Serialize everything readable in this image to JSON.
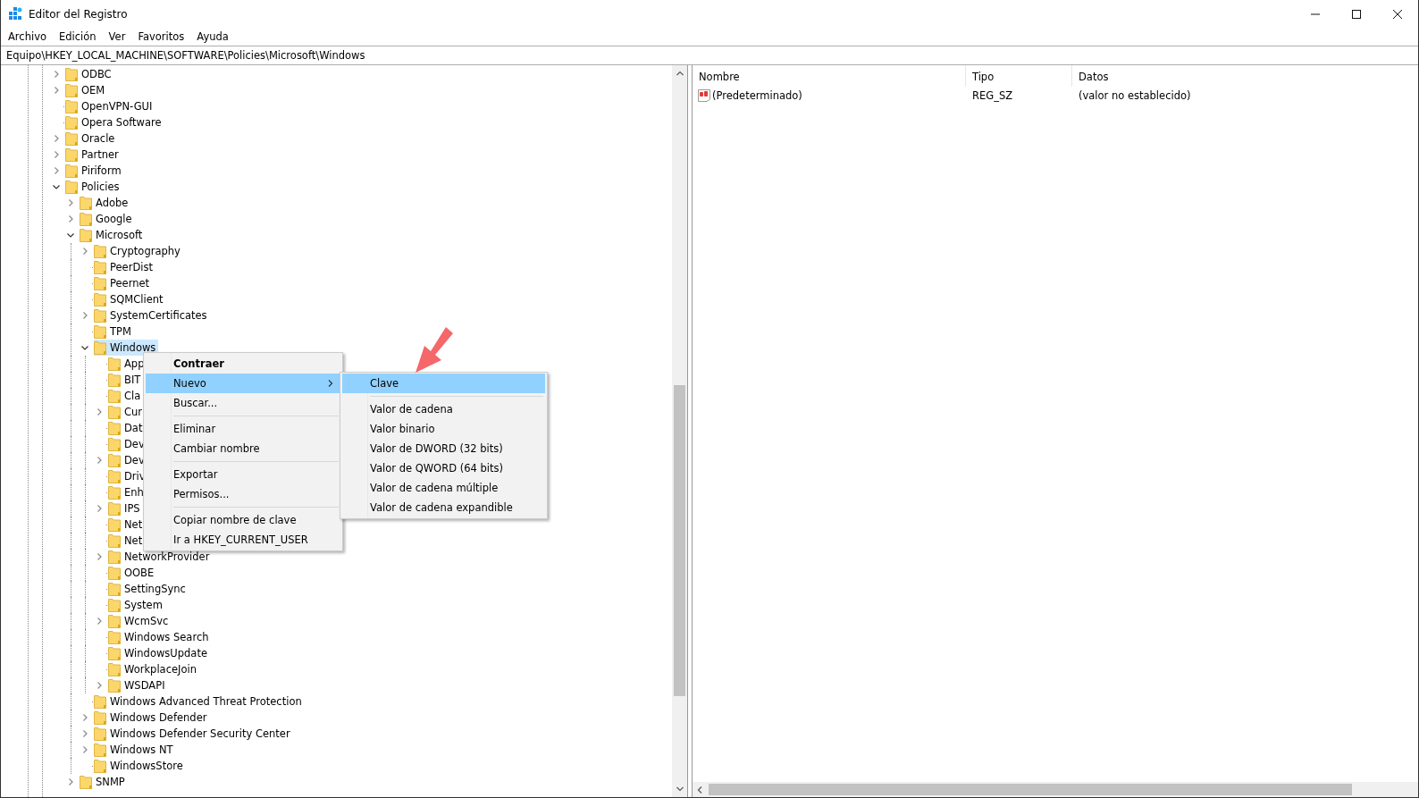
{
  "window": {
    "title": "Editor del Registro"
  },
  "menu_bar": [
    "Archivo",
    "Edición",
    "Ver",
    "Favoritos",
    "Ayuda"
  ],
  "address": "Equipo\\HKEY_LOCAL_MACHINE\\SOFTWARE\\Policies\\Microsoft\\Windows",
  "tree": [
    {
      "label": "ODBC",
      "kind": "closed",
      "selected": false
    },
    {
      "label": "OEM",
      "kind": "closed",
      "selected": false
    },
    {
      "label": "OpenVPN-GUI",
      "kind": "leaf",
      "selected": false
    },
    {
      "label": "Opera Software",
      "kind": "leaf",
      "selected": false
    },
    {
      "label": "Oracle",
      "kind": "closed",
      "selected": false
    },
    {
      "label": "Partner",
      "kind": "closed",
      "selected": false
    },
    {
      "label": "Piriform",
      "kind": "closed",
      "selected": false
    },
    {
      "label": "Policies",
      "kind": "open",
      "selected": false,
      "children": [
        {
          "label": "Adobe",
          "kind": "closed",
          "selected": false
        },
        {
          "label": "Google",
          "kind": "closed",
          "selected": false
        },
        {
          "label": "Microsoft",
          "kind": "open",
          "selected": false,
          "children": [
            {
              "label": "Cryptography",
              "kind": "closed",
              "selected": false
            },
            {
              "label": "PeerDist",
              "kind": "leaf",
              "selected": false
            },
            {
              "label": "Peernet",
              "kind": "leaf",
              "selected": false
            },
            {
              "label": "SQMClient",
              "kind": "leaf",
              "selected": false
            },
            {
              "label": "SystemCertificates",
              "kind": "closed",
              "selected": false
            },
            {
              "label": "TPM",
              "kind": "leaf",
              "selected": false
            },
            {
              "label": "Windows",
              "kind": "open",
              "selected": true,
              "children": [
                {
                  "label": "App",
                  "kind": "leaf",
                  "selected": false
                },
                {
                  "label": "BIT",
                  "kind": "leaf",
                  "selected": false
                },
                {
                  "label": "Cla",
                  "kind": "leaf",
                  "selected": false
                },
                {
                  "label": "Cur",
                  "kind": "closed",
                  "selected": false
                },
                {
                  "label": "Dat",
                  "kind": "leaf",
                  "selected": false
                },
                {
                  "label": "Dev",
                  "kind": "leaf",
                  "selected": false
                },
                {
                  "label": "Dev",
                  "kind": "closed",
                  "selected": false
                },
                {
                  "label": "Driv",
                  "kind": "leaf",
                  "selected": false
                },
                {
                  "label": "Enh",
                  "kind": "leaf",
                  "selected": false
                },
                {
                  "label": "IPS",
                  "kind": "closed",
                  "selected": false
                },
                {
                  "label": "Net",
                  "kind": "leaf",
                  "selected": false
                },
                {
                  "label": "Net",
                  "kind": "leaf",
                  "selected": false
                },
                {
                  "label": "NetworkProvider",
                  "kind": "closed",
                  "selected": false
                },
                {
                  "label": "OOBE",
                  "kind": "leaf",
                  "selected": false
                },
                {
                  "label": "SettingSync",
                  "kind": "leaf",
                  "selected": false
                },
                {
                  "label": "System",
                  "kind": "leaf",
                  "selected": false
                },
                {
                  "label": "WcmSvc",
                  "kind": "closed",
                  "selected": false
                },
                {
                  "label": "Windows Search",
                  "kind": "leaf",
                  "selected": false
                },
                {
                  "label": "WindowsUpdate",
                  "kind": "leaf",
                  "selected": false
                },
                {
                  "label": "WorkplaceJoin",
                  "kind": "leaf",
                  "selected": false
                },
                {
                  "label": "WSDAPI",
                  "kind": "closed",
                  "selected": false
                }
              ]
            },
            {
              "label": "Windows Advanced Threat Protection",
              "kind": "leaf",
              "selected": false
            },
            {
              "label": "Windows Defender",
              "kind": "closed",
              "selected": false
            },
            {
              "label": "Windows Defender Security Center",
              "kind": "closed",
              "selected": false
            },
            {
              "label": "Windows NT",
              "kind": "closed",
              "selected": false
            },
            {
              "label": "WindowsStore",
              "kind": "leaf",
              "selected": false
            }
          ]
        },
        {
          "label": "SNMP",
          "kind": "closed",
          "selected": false
        }
      ]
    }
  ],
  "values_table": {
    "columns": [
      "Nombre",
      "Tipo",
      "Datos"
    ],
    "rows": [
      {
        "name": "(Predeterminado)",
        "type": "REG_SZ",
        "data": "(valor no establecido)"
      }
    ]
  },
  "context_menu": {
    "items": [
      {
        "kind": "item",
        "label": "Contraer",
        "default": true,
        "selected": false,
        "submenu": false
      },
      {
        "kind": "item",
        "label": "Nuevo",
        "default": false,
        "selected": true,
        "submenu": true
      },
      {
        "kind": "item",
        "label": "Buscar...",
        "default": false,
        "selected": false,
        "submenu": false
      },
      {
        "kind": "separator"
      },
      {
        "kind": "item",
        "label": "Eliminar",
        "default": false,
        "selected": false,
        "submenu": false
      },
      {
        "kind": "item",
        "label": "Cambiar nombre",
        "default": false,
        "selected": false,
        "submenu": false
      },
      {
        "kind": "separator"
      },
      {
        "kind": "item",
        "label": "Exportar",
        "default": false,
        "selected": false,
        "submenu": false
      },
      {
        "kind": "item",
        "label": "Permisos...",
        "default": false,
        "selected": false,
        "submenu": false
      },
      {
        "kind": "separator"
      },
      {
        "kind": "item",
        "label": "Copiar nombre de clave",
        "default": false,
        "selected": false,
        "submenu": false
      },
      {
        "kind": "item",
        "label": "Ir a HKEY_CURRENT_USER",
        "default": false,
        "selected": false,
        "submenu": false
      }
    ]
  },
  "submenu": {
    "items": [
      {
        "kind": "item",
        "label": "Clave",
        "selected": true
      },
      {
        "kind": "separator"
      },
      {
        "kind": "item",
        "label": "Valor de cadena",
        "selected": false
      },
      {
        "kind": "item",
        "label": "Valor binario",
        "selected": false
      },
      {
        "kind": "item",
        "label": "Valor de DWORD (32 bits)",
        "selected": false
      },
      {
        "kind": "item",
        "label": "Valor de QWORD (64 bits)",
        "selected": false
      },
      {
        "kind": "item",
        "label": "Valor de cadena múltiple",
        "selected": false
      },
      {
        "kind": "item",
        "label": "Valor de cadena expandible",
        "selected": false
      }
    ]
  }
}
